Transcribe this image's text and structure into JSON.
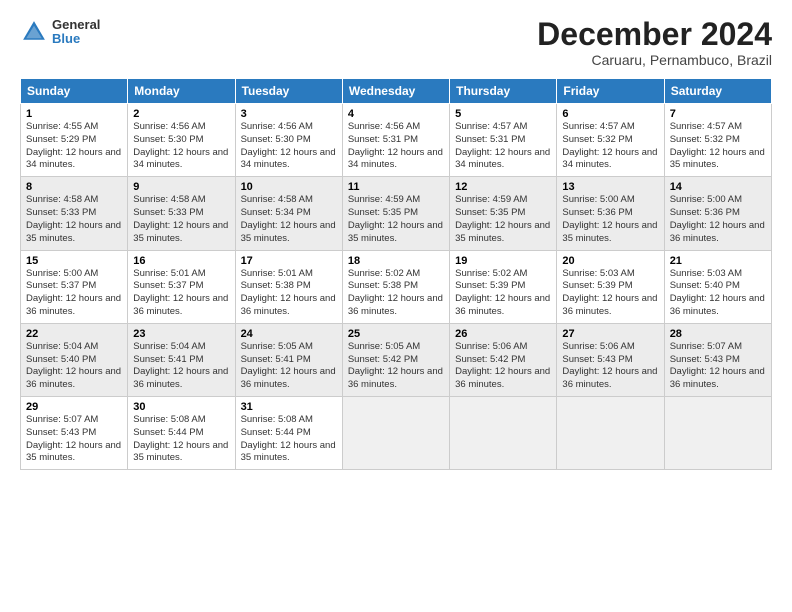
{
  "header": {
    "logo": {
      "general": "General",
      "blue": "Blue"
    },
    "title": "December 2024",
    "location": "Caruaru, Pernambuco, Brazil"
  },
  "calendar": {
    "days_of_week": [
      "Sunday",
      "Monday",
      "Tuesday",
      "Wednesday",
      "Thursday",
      "Friday",
      "Saturday"
    ],
    "weeks": [
      [
        {
          "day": "1",
          "sunrise": "4:55 AM",
          "sunset": "5:29 PM",
          "daylight": "12 hours and 34 minutes."
        },
        {
          "day": "2",
          "sunrise": "4:56 AM",
          "sunset": "5:30 PM",
          "daylight": "12 hours and 34 minutes."
        },
        {
          "day": "3",
          "sunrise": "4:56 AM",
          "sunset": "5:30 PM",
          "daylight": "12 hours and 34 minutes."
        },
        {
          "day": "4",
          "sunrise": "4:56 AM",
          "sunset": "5:31 PM",
          "daylight": "12 hours and 34 minutes."
        },
        {
          "day": "5",
          "sunrise": "4:57 AM",
          "sunset": "5:31 PM",
          "daylight": "12 hours and 34 minutes."
        },
        {
          "day": "6",
          "sunrise": "4:57 AM",
          "sunset": "5:32 PM",
          "daylight": "12 hours and 34 minutes."
        },
        {
          "day": "7",
          "sunrise": "4:57 AM",
          "sunset": "5:32 PM",
          "daylight": "12 hours and 35 minutes."
        }
      ],
      [
        {
          "day": "8",
          "sunrise": "4:58 AM",
          "sunset": "5:33 PM",
          "daylight": "12 hours and 35 minutes."
        },
        {
          "day": "9",
          "sunrise": "4:58 AM",
          "sunset": "5:33 PM",
          "daylight": "12 hours and 35 minutes."
        },
        {
          "day": "10",
          "sunrise": "4:58 AM",
          "sunset": "5:34 PM",
          "daylight": "12 hours and 35 minutes."
        },
        {
          "day": "11",
          "sunrise": "4:59 AM",
          "sunset": "5:35 PM",
          "daylight": "12 hours and 35 minutes."
        },
        {
          "day": "12",
          "sunrise": "4:59 AM",
          "sunset": "5:35 PM",
          "daylight": "12 hours and 35 minutes."
        },
        {
          "day": "13",
          "sunrise": "5:00 AM",
          "sunset": "5:36 PM",
          "daylight": "12 hours and 35 minutes."
        },
        {
          "day": "14",
          "sunrise": "5:00 AM",
          "sunset": "5:36 PM",
          "daylight": "12 hours and 36 minutes."
        }
      ],
      [
        {
          "day": "15",
          "sunrise": "5:00 AM",
          "sunset": "5:37 PM",
          "daylight": "12 hours and 36 minutes."
        },
        {
          "day": "16",
          "sunrise": "5:01 AM",
          "sunset": "5:37 PM",
          "daylight": "12 hours and 36 minutes."
        },
        {
          "day": "17",
          "sunrise": "5:01 AM",
          "sunset": "5:38 PM",
          "daylight": "12 hours and 36 minutes."
        },
        {
          "day": "18",
          "sunrise": "5:02 AM",
          "sunset": "5:38 PM",
          "daylight": "12 hours and 36 minutes."
        },
        {
          "day": "19",
          "sunrise": "5:02 AM",
          "sunset": "5:39 PM",
          "daylight": "12 hours and 36 minutes."
        },
        {
          "day": "20",
          "sunrise": "5:03 AM",
          "sunset": "5:39 PM",
          "daylight": "12 hours and 36 minutes."
        },
        {
          "day": "21",
          "sunrise": "5:03 AM",
          "sunset": "5:40 PM",
          "daylight": "12 hours and 36 minutes."
        }
      ],
      [
        {
          "day": "22",
          "sunrise": "5:04 AM",
          "sunset": "5:40 PM",
          "daylight": "12 hours and 36 minutes."
        },
        {
          "day": "23",
          "sunrise": "5:04 AM",
          "sunset": "5:41 PM",
          "daylight": "12 hours and 36 minutes."
        },
        {
          "day": "24",
          "sunrise": "5:05 AM",
          "sunset": "5:41 PM",
          "daylight": "12 hours and 36 minutes."
        },
        {
          "day": "25",
          "sunrise": "5:05 AM",
          "sunset": "5:42 PM",
          "daylight": "12 hours and 36 minutes."
        },
        {
          "day": "26",
          "sunrise": "5:06 AM",
          "sunset": "5:42 PM",
          "daylight": "12 hours and 36 minutes."
        },
        {
          "day": "27",
          "sunrise": "5:06 AM",
          "sunset": "5:43 PM",
          "daylight": "12 hours and 36 minutes."
        },
        {
          "day": "28",
          "sunrise": "5:07 AM",
          "sunset": "5:43 PM",
          "daylight": "12 hours and 36 minutes."
        }
      ],
      [
        {
          "day": "29",
          "sunrise": "5:07 AM",
          "sunset": "5:43 PM",
          "daylight": "12 hours and 35 minutes."
        },
        {
          "day": "30",
          "sunrise": "5:08 AM",
          "sunset": "5:44 PM",
          "daylight": "12 hours and 35 minutes."
        },
        {
          "day": "31",
          "sunrise": "5:08 AM",
          "sunset": "5:44 PM",
          "daylight": "12 hours and 35 minutes."
        },
        null,
        null,
        null,
        null
      ]
    ]
  }
}
